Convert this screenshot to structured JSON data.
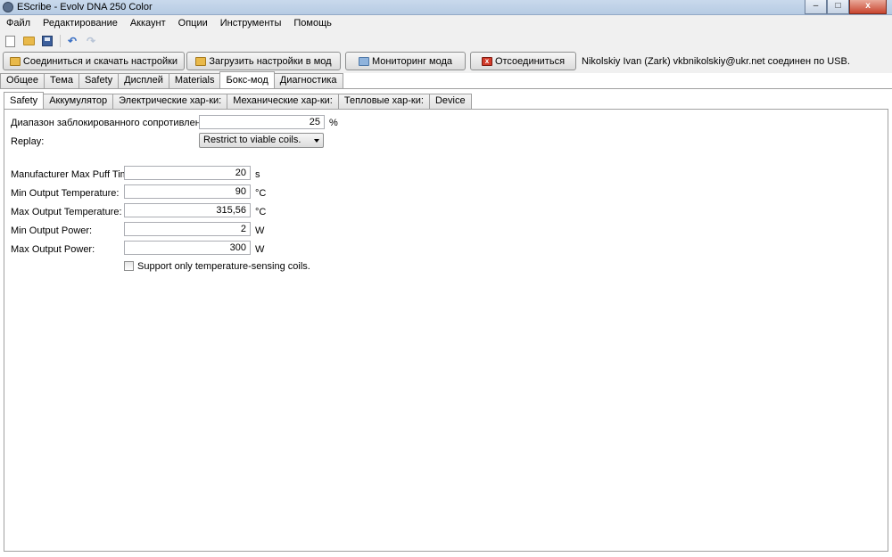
{
  "window": {
    "title": "EScribe - Evolv DNA 250 Color",
    "minimize": "–",
    "maximize": "□",
    "close": "x"
  },
  "menu": [
    "Файл",
    "Редактирование",
    "Аккаунт",
    "Опции",
    "Инструменты",
    "Помощь"
  ],
  "toolbar_icons": [
    "new-file-icon",
    "open-folder-icon",
    "save-icon",
    "undo-icon",
    "redo-icon"
  ],
  "actions": {
    "connect": "Соединиться и скачать настройки",
    "upload": "Загрузить настройки в мод",
    "monitor": "Мониторинг мода",
    "disconnect": "Отсоединиться"
  },
  "status": "Nikolskiy Ivan (Zark)  vkbnikolskiy@ukr.net соединен по USB.",
  "tabs": [
    "Общее",
    "Тема",
    "Safety",
    "Дисплей",
    "Materials",
    "Бокс-мод",
    "Диагностика"
  ],
  "active_tab": "Бокс-мод",
  "subtabs": [
    "Safety",
    "Аккумулятор",
    "Электрические хар-ки:",
    "Механические хар-ки:",
    "Тепловые хар-ки:",
    "Device"
  ],
  "active_subtab": "Safety",
  "form": {
    "locked_resistance": {
      "label": "Диапазон заблокированного сопротивления: ±",
      "value": "25",
      "unit": "%"
    },
    "replay": {
      "label": "Replay:",
      "value": "Restrict to viable coils."
    },
    "max_puff": {
      "label": "Manufacturer Max Puff Time:",
      "value": "20",
      "unit": "s"
    },
    "min_temp": {
      "label": "Min Output Temperature:",
      "value": "90",
      "unit": "°C"
    },
    "max_temp": {
      "label": "Max Output Temperature:",
      "value": "315,56",
      "unit": "°C"
    },
    "min_power": {
      "label": "Min Output Power:",
      "value": "2",
      "unit": "W"
    },
    "max_power": {
      "label": "Max Output Power:",
      "value": "300",
      "unit": "W"
    },
    "temp_only": {
      "label": "Support only temperature-sensing coils.",
      "checked": false
    }
  },
  "colors": {
    "titlebar": "#c9d9ec",
    "chrome": "#f0f0f0",
    "border": "#a0a0a0"
  }
}
